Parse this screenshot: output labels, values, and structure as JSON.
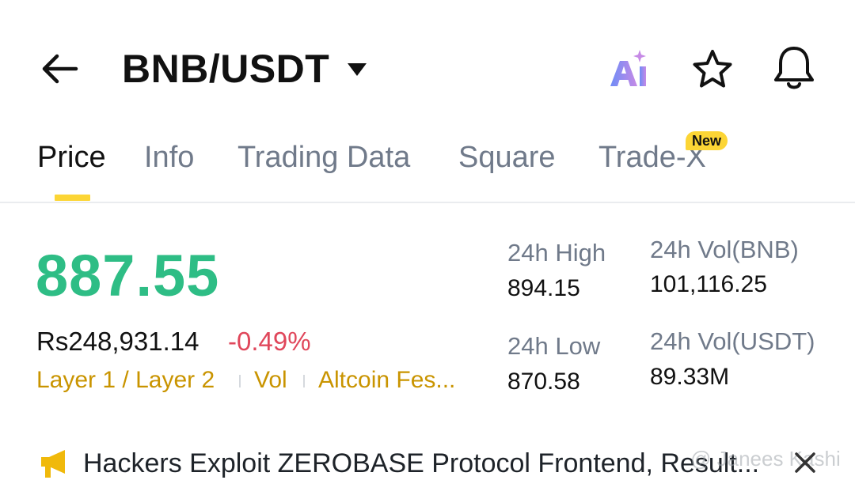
{
  "header": {
    "pair": "BNB/USDT",
    "icons": [
      "back-arrow-icon",
      "dropdown-caret-icon",
      "ai-icon",
      "star-icon",
      "bell-icon"
    ]
  },
  "tabs": [
    {
      "label": "Price",
      "active": true
    },
    {
      "label": "Info",
      "active": false
    },
    {
      "label": "Trading Data",
      "active": false
    },
    {
      "label": "Square",
      "active": false
    },
    {
      "label": "Trade-X",
      "active": false,
      "badge": "New"
    }
  ],
  "price": {
    "last": "887.55",
    "fiat": "Rs248,931.14",
    "change": "-0.49%",
    "tags": [
      "Layer 1 / Layer 2",
      "Vol",
      "Altcoin Fes..."
    ]
  },
  "stats": {
    "high_label": "24h High",
    "high_value": "894.15",
    "low_label": "24h Low",
    "low_value": "870.58",
    "vol_base_label": "24h Vol(BNB)",
    "vol_base_value": "101,116.25",
    "vol_quote_label": "24h Vol(USDT)",
    "vol_quote_value": "89.33M"
  },
  "news": {
    "headline": "Hackers Exploit ZEROBASE Protocol Frontend, Result...",
    "icon": "megaphone-icon"
  },
  "watermark": "@ Janees Kashi",
  "colors": {
    "accent": "#fcd535",
    "up": "#2ebd85",
    "down": "#e0475b",
    "tag": "#c99400",
    "muted": "#707a8a"
  }
}
